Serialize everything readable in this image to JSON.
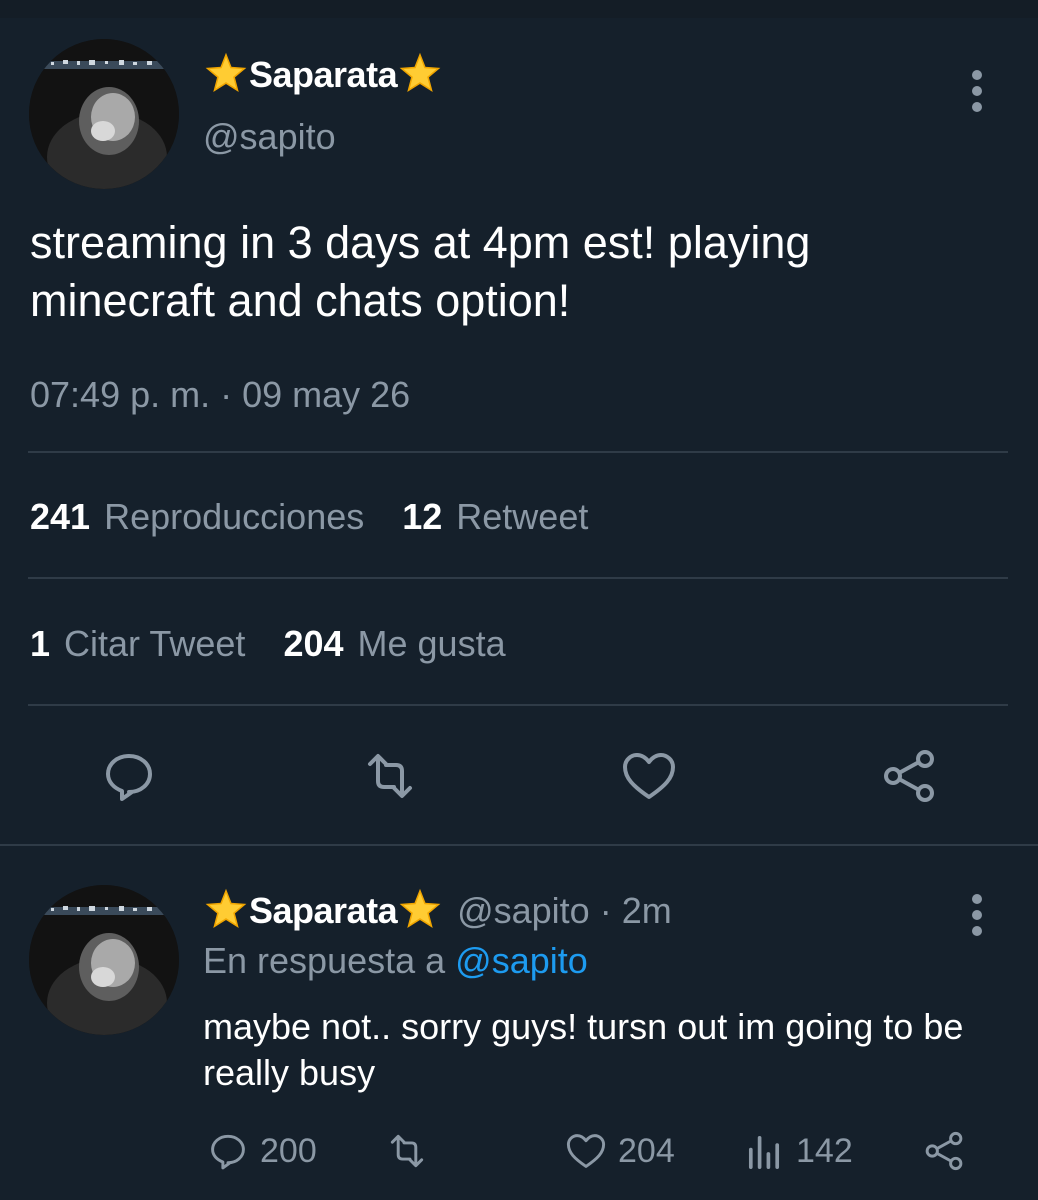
{
  "tweet": {
    "display_name": "Saparata",
    "handle": "@sapito",
    "text": "streaming in 3 days at 4pm est! playing minecraft and chats option!",
    "timestamp": "07:49 p. m. · 09 may 26",
    "stats": {
      "views_count": "241",
      "views_label": "Reproducciones",
      "retweets_count": "12",
      "retweets_label": "Retweet",
      "quotes_count": "1",
      "quotes_label": "Citar Tweet",
      "likes_count": "204",
      "likes_label": "Me gusta"
    }
  },
  "reply": {
    "display_name": "Saparata",
    "handle_time": "@sapito · 2m",
    "in_reply_prefix": "En respuesta a",
    "in_reply_handle": "@sapito",
    "text": "maybe not.. sorry guys! tursn out im going to be really busy",
    "actions": {
      "replies": "200",
      "likes": "204",
      "views": "142"
    }
  },
  "colors": {
    "background": "#15202b",
    "secondary_text": "#8b98a5",
    "link": "#1d9bf0",
    "divider": "#2f3b47",
    "star": "#ffcc33"
  },
  "icons": [
    "more-icon",
    "reply-icon",
    "retweet-icon",
    "like-icon",
    "share-icon",
    "views-icon",
    "star-emoji"
  ]
}
